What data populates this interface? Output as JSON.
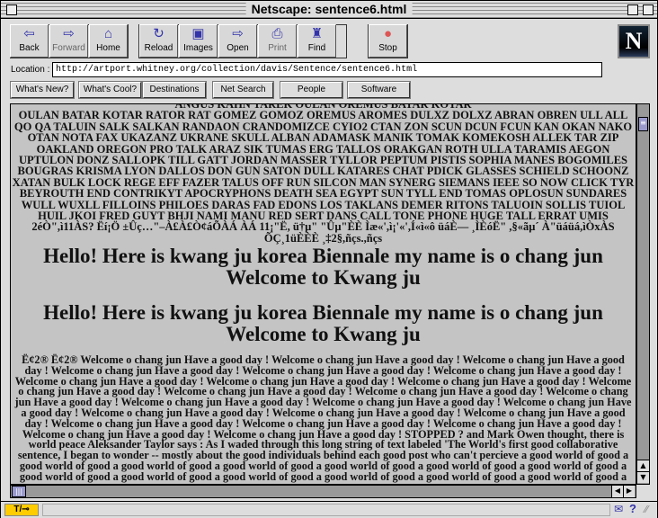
{
  "window": {
    "title": "Netscape: sentence6.html"
  },
  "toolbar": {
    "buttons": [
      {
        "label": "Back",
        "icon": "back-arrow-icon",
        "glyph": "⇦"
      },
      {
        "label": "Forward",
        "icon": "forward-arrow-icon",
        "glyph": "⇨"
      },
      {
        "label": "Home",
        "icon": "home-icon",
        "glyph": "⌂"
      },
      {
        "label": "Reload",
        "icon": "reload-icon",
        "glyph": "↻"
      },
      {
        "label": "Images",
        "icon": "images-icon",
        "glyph": "▣"
      },
      {
        "label": "Open",
        "icon": "open-icon",
        "glyph": "⇨"
      },
      {
        "label": "Print",
        "icon": "print-icon",
        "glyph": "⎙"
      },
      {
        "label": "Find",
        "icon": "find-icon",
        "glyph": "♜"
      },
      {
        "label": "Stop",
        "icon": "stop-icon",
        "glyph": "●"
      }
    ],
    "logo": "N"
  },
  "location": {
    "label": "Location :",
    "url": "http://artport.whitney.org/collection/davis/Sentence/sentence6.html"
  },
  "directory": [
    "What's New?",
    "What's Cool?",
    "Destinations",
    "Net Search",
    "People",
    "Software"
  ],
  "content": {
    "top_lines": [
      "ANGUS KAHN TAREK OULAN OREMUS BATAR KOTAR",
      "OULAN BATAR KOTAR RATOR RAT GOMEZ GOMOZ OREMUS AROMES DULXZ DOLXZ ABRAN OBREN ULL ALL",
      "QO QA TALUIN SALK SALKAN RANDAON CRANDOMIZCE CYIO2 CTAN ZON SCUN DCUN FCUN KAN OKAN NAKO",
      "OTAN NOTA FAX UKAZANZ UKRANE SKULL ALBAN ADAMASK MANIK TOMAK KOMEKOSH ALLEK TAR ZIP",
      "OAKLAND OREGON PRO TALK ARAZ SIK TUMAS ERG TALLOS ORAKGAN ROTH ULLA TARAMIS AEGON",
      "UPTULON DONZ SALLOPK TILL GATT JORDAN MASSER TYLLOR PEPTUM PISTIS SOPHIA MANES BOGOMILES",
      "BOUGRAS KRISMA LYON DALLOS DON GUN SATON DULL KATARES CHAT PDICK GLASSES SCHIELD SCHOONZ",
      "XATAN BULK LOCK REGE EFF FAZER TALUS OFF RUN SILCON MAN SYNERG SIEMANS IEEE SO NOW CLICK TYR",
      "BEYROUTH END CONTRIKYT APOCRYPHONS DEATH SEA EGYPT SUN TYLL END TOMAS OPLOSUN SUNDARES",
      "WULL WUXLL FILLOINS PHILOES DARAS FAD EDONS LOS TAKLANS DEMER RITONS TALUOIN SOLLIS TUIOL",
      "HUIL JKOI FRED GUYT BHJI NAMI MANU RED SERT DANS CALL TONE PHONE HUGE TALL ERRAT UMIS",
      "2éÒ\",ì11ÀS? Ëí¡Ö ±Ûç…\"–À£À£Ò¢áÕÀÁ ÀÁ 11¡\"Ë, ü†µ\" \"Ûµ\"ÈÈ Ìæ«',ì¡'«',Í«ì«ô üáÈ— ¸ÌÈóË\" ,§«ãµ´ À\"üáüá,ìÒxÀS",
      "ÕÇ¸1üÈÈÈ ¸‡2§,ñçs.,ñçs"
    ],
    "headings": [
      "Hello! Here is kwang ju korea Biennale my name is o chang jun",
      "Welcome to Kwang ju",
      "Hello! Here is kwang ju korea Biennale my name is o chang jun",
      "Welcome to Kwang ju"
    ],
    "para_lines": [
      "Ë¢2® Ë¢2® Welcome o chang jun Have a good day ! Welcome o chang jun Have a good day ! Welcome o chang jun Have a good",
      "day ! Welcome o chang jun Have a good day ! Welcome o chang jun Have a good day ! Welcome o chang jun Have a good day !",
      "Welcome o chang jun Have a good day ! Welcome o chang jun Have a good day ! Welcome o chang jun Have a good day ! Welcome",
      "o chang jun Have a good day ! Welcome o chang jun Have a good day ! Welcome o chang jun Have a good day ! Welcome o chang",
      "jun Have a good day ! Welcome o chang jun Have a good day ! Welcome o chang jun Have a good day ! Welcome o chang jun Have",
      "a good day ! Welcome o chang jun Have a good day ! Welcome o chang jun Have a good day ! Welcome o chang jun Have a good",
      "day ! Welcome o chang jun Have a good day ! Welcome o chang jun Have a good day ! Welcome o chang jun Have a good day !",
      "Welcome o chang jun Have a good day ! Welcome o chang jun Have a good day ! STOPPED ? and Mark Owen thought, there is",
      "world peace Aleksander Taylor says : As I waded through this long string of text labeled 'The World's first good collaborative",
      "sentence, I began to wonder -- mostly about the good individuals behind each good post who can't percieve a good world of good a",
      "good world of good a good world of good a good world of good a good world of good a good world of good a good world of good a",
      "good world of good a good world of good a good world of good a good world of good a good world of good a good world of good a"
    ]
  },
  "status": {
    "security": "T/⊸"
  }
}
